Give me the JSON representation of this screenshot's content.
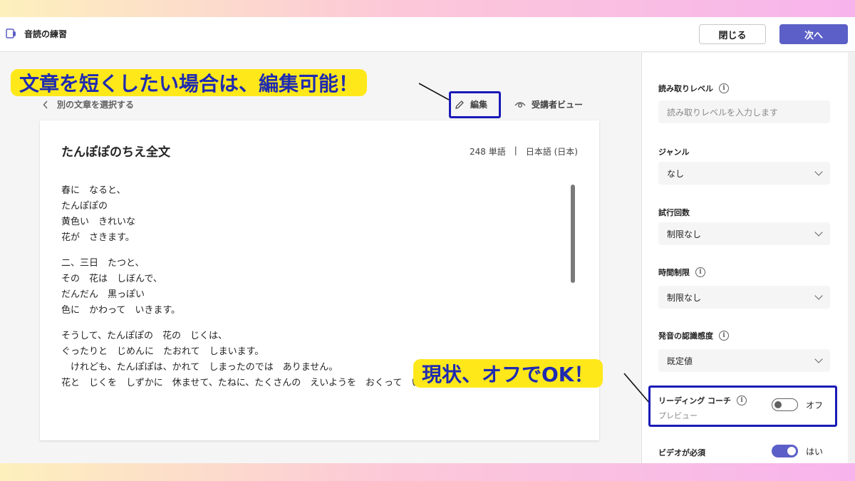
{
  "app": {
    "title": "音読の練習",
    "close_label": "閉じる",
    "next_label": "次へ"
  },
  "toolbar": {
    "back_label": "別の文章を選択する",
    "edit_label": "編集",
    "viewer_label": "受講者ビュー"
  },
  "passage": {
    "title": "たんぽぽのちえ全文",
    "word_count": "248 単語",
    "separator": "|",
    "language": "日本語 (日本)",
    "stanzas": [
      [
        "春に　なると、",
        "たんぽぽの",
        "黄色い　きれいな",
        "花が　さきます。"
      ],
      [
        "二、三日　たつと、",
        "その　花は　しぼんで、",
        "だんだん　黒っぽい",
        "色に　かわって　いきます。"
      ],
      [
        "そうして、たんぽぽの　花の　じくは、",
        "ぐったりと　じめんに　たおれて　しまいます。",
        "　けれども、たんぽぽは、かれて　しまったのでは　ありません。",
        "花と　じくを　しずかに　休ませて、たねに、たくさんの　えいようを　おくって　いるのです。"
      ]
    ]
  },
  "settings": {
    "reading_level": {
      "label": "読み取りレベル",
      "placeholder": "読み取りレベルを入力します"
    },
    "genre": {
      "label": "ジャンル",
      "value": "なし"
    },
    "attempts": {
      "label": "試行回数",
      "value": "制限なし"
    },
    "time_limit": {
      "label": "時間制限",
      "value": "制限なし"
    },
    "pronunciation": {
      "label": "発音の認識感度",
      "value": "既定値"
    },
    "reading_coach": {
      "label": "リーディング コーチ",
      "sublabel": "プレビュー",
      "state": "オフ",
      "enabled": false
    },
    "video_required": {
      "label": "ビデオが必須",
      "state": "はい",
      "enabled": true
    }
  },
  "annotations": {
    "edit_callout": "文章を短くしたい場合は、編集可能！",
    "coach_callout": "現状、オフでOK！",
    "callout_bg": "#ffe81a",
    "callout_text": "#1f2bb0",
    "highlight_border": "#1a1ab8"
  },
  "colors": {
    "accent": "#5b5fc7"
  }
}
